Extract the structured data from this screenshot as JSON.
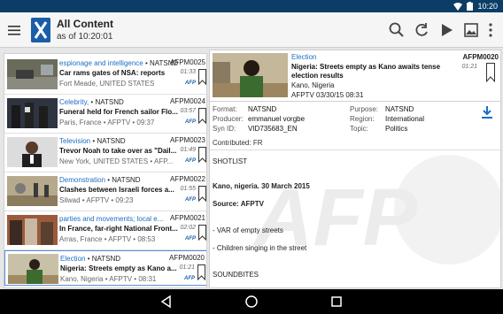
{
  "status_bar": {
    "clock": "10:20"
  },
  "app_bar": {
    "title": "All Content",
    "subtitle": "as of 10:20:01",
    "actions": [
      "search-icon",
      "refresh-icon",
      "play-icon",
      "image-icon",
      "overflow-menu-icon"
    ]
  },
  "list": [
    {
      "category": "espionage and intelligence",
      "source": "NATSND",
      "id": "AFPM0025",
      "headline": "Car rams gates of NSA: reports",
      "duration": "01:33",
      "location": "Fort Meade, UNITED STATES",
      "source_tag": "AFP"
    },
    {
      "category": "Celebrity,",
      "source": "NATSND",
      "id": "AFPM0024",
      "headline": "Funeral held for French sailor Flo...",
      "duration": "03:57",
      "location": "Paris, France",
      "agency": "AFPTV",
      "time": "09:37",
      "source_tag": "AFP"
    },
    {
      "category": "Television",
      "source": "NATSND",
      "id": "AFPM0023",
      "headline": "Trevor Noah to take over as \"Dail...",
      "duration": "01:49",
      "location": "New York, UNITED STATES",
      "agency": "AFP...",
      "source_tag": "AFP"
    },
    {
      "category": "Demonstration",
      "source": "NATSND",
      "id": "AFPM0022",
      "headline": "Clashes between Israeli forces a...",
      "duration": "01:55",
      "location": "Silwad",
      "agency": "AFPTV",
      "time": "09:23",
      "source_tag": "AFP"
    },
    {
      "category": "parties and movements; local e...",
      "source": "",
      "id": "AFPM0021",
      "headline": "In France, far-right National Front...",
      "duration": "02:02",
      "location": "Arras, France",
      "agency": "AFPTV",
      "time": "08:53",
      "source_tag": "AFP"
    },
    {
      "category": "Election",
      "source": "NATSND",
      "id": "AFPM0020",
      "headline": "Nigeria: Streets empty as Kano a...",
      "duration": "01:21",
      "location": "Kano, Nigeria",
      "agency": "AFPTV",
      "time": "08:31",
      "source_tag": "AFP",
      "selected": true
    }
  ],
  "detail": {
    "category": "Election",
    "id": "AFPM0020",
    "headline": "Nigeria: Streets empty as Kano awaits tense election results",
    "duration": "01:21",
    "location": "Kano, Nigeria",
    "agency_date": "AFPTV 03/30/15 08:31",
    "meta": {
      "format_label": "Format:",
      "format": "NATSND",
      "producer_label": "Producer:",
      "producer": "emmanuel vorgbe",
      "synid_label": "Syn ID:",
      "synid": "VID735683_EN",
      "purpose_label": "Purpose:",
      "purpose": "NATSND",
      "region_label": "Region:",
      "region": "International",
      "topic_label": "Topic:",
      "topic": "Politics",
      "contributed_label": "Contributed:",
      "contributed": "FR"
    },
    "body": {
      "shotlist": "SHOTLIST",
      "dateline": "Kano, nigeria. 30 March 2015",
      "source": "Source: AFPTV",
      "line1": "- VAR of empty streets",
      "line2": "- Children singing in the street",
      "soundbites": "SOUNDBITES"
    },
    "watermark": "AFP"
  },
  "colors": {
    "accent": "#1c6ec7",
    "status_bar": "#0b3d66",
    "selected_border": "#5a8fd8"
  }
}
